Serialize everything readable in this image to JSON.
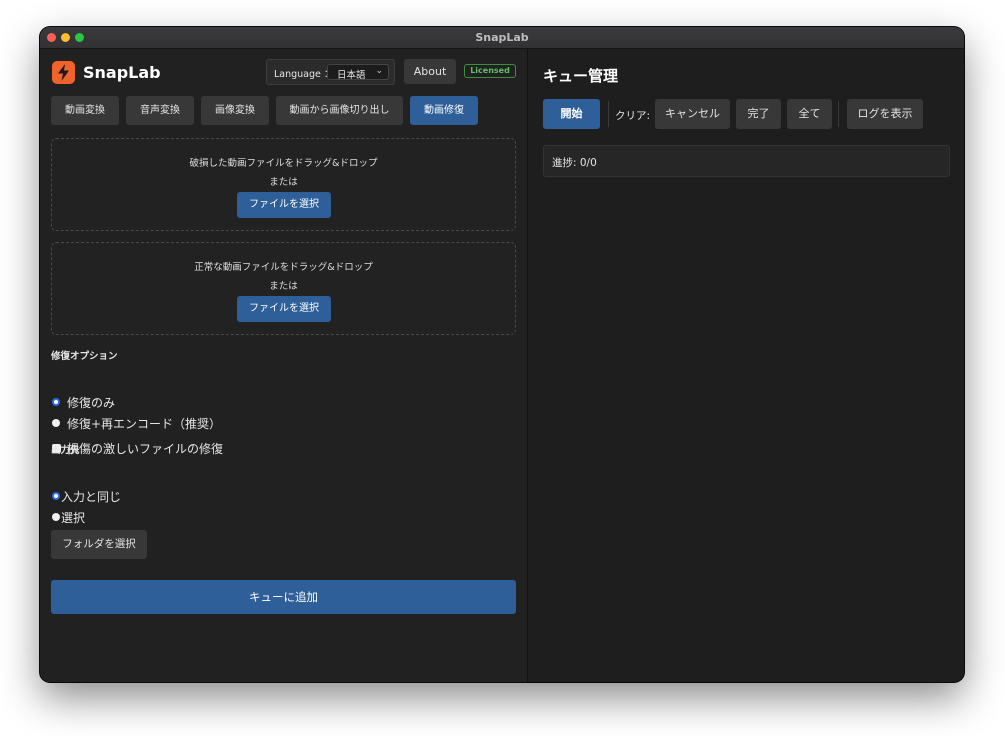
{
  "window": {
    "title": "SnapLab"
  },
  "app": {
    "name": "SnapLab"
  },
  "header": {
    "language_label": "Language ：",
    "language_value": "日本語",
    "about_label": "About",
    "license_badge": "Licensed"
  },
  "tabs": [
    {
      "label": "動画変換",
      "active": false
    },
    {
      "label": "音声変換",
      "active": false
    },
    {
      "label": "画像変換",
      "active": false
    },
    {
      "label": "動画から画像切り出し",
      "active": false
    },
    {
      "label": "動画修復",
      "active": true
    }
  ],
  "dropzones": [
    {
      "text": "破損した動画ファイルをドラッグ&ドロップ",
      "or": "または",
      "button": "ファイルを選択"
    },
    {
      "text": "正常な動画ファイルをドラッグ&ドロップ",
      "or": "または",
      "button": "ファイルを選択"
    }
  ],
  "repair_options": {
    "label": "修復オプション",
    "radio_repair_only": {
      "label": "修復のみ",
      "selected": true
    },
    "radio_repair_reencode": {
      "label": "修復+再エンコード（推奨）",
      "selected": false
    },
    "check_severe": {
      "label": "損傷の激しいファイルの修復",
      "checked": false
    }
  },
  "output": {
    "label": "出力先",
    "radio_same": {
      "label": "入力と同じ",
      "selected": true
    },
    "radio_select": {
      "label": "選択",
      "selected": false
    },
    "folder_button": "フォルダを選択"
  },
  "add_to_queue": "キューに追加",
  "queue": {
    "title": "キュー管理",
    "start": "開始",
    "clear_label": "クリア:",
    "cancel": "キャンセル",
    "done": "完了",
    "all": "全て",
    "show_log": "ログを表示",
    "progress": "進捗: 0/0"
  },
  "colors": {
    "primary": "#2e5f99",
    "logo": "#f2622b",
    "licensed": "#5fbf63"
  }
}
